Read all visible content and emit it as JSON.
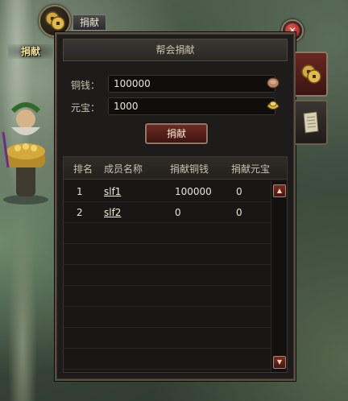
{
  "scene": {
    "donate_badge": "捐献"
  },
  "tab": {
    "label": "捐献"
  },
  "panel": {
    "title": "帮会捐献",
    "copper_label": "铜钱：",
    "copper_value": "100000",
    "yuanbao_label": "元宝：",
    "yuanbao_value": "1000",
    "donate_button": "捐献"
  },
  "table": {
    "headers": [
      "排名",
      "成员名称",
      "捐献铜钱",
      "捐献元宝"
    ],
    "rows": [
      {
        "rank": "1",
        "name": "slf1",
        "copper": "100000",
        "yuanbao": "0"
      },
      {
        "rank": "2",
        "name": "slf2",
        "copper": "0",
        "yuanbao": "0"
      }
    ]
  },
  "colors": {
    "accent_red": "#6e2b24",
    "border_gold": "#8c7a64",
    "panel_bg": "#1d1c1a"
  },
  "icons": {
    "coin_tab": "coins-icon",
    "close": "close-icon",
    "copper": "copper-coin-icon",
    "yuanbao": "gold-ingot-icon",
    "side_coins": "coins-icon",
    "side_scroll": "scroll-icon"
  }
}
